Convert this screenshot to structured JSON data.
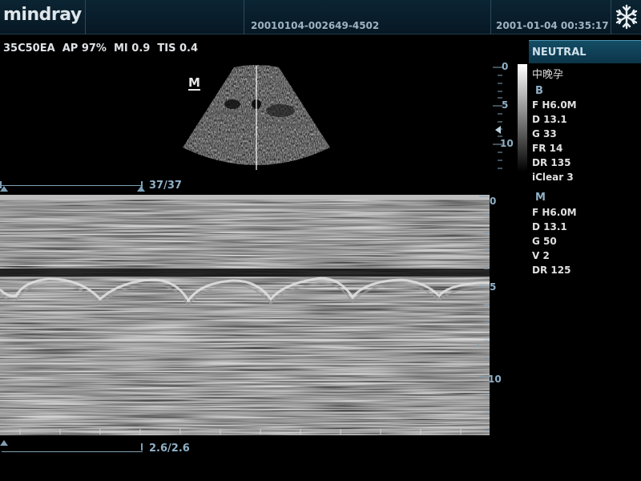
{
  "topbar": {
    "logo": "mindray",
    "patient_id": "20010104-002649-4502",
    "datetime": "2001-01-04 00:35:17",
    "freeze_icon": "snowflake-icon"
  },
  "imaging_params": "35C50EA  AP 97%  MI 0.9  TIS 0.4",
  "sector_label": "M",
  "right_panel": {
    "preset": "NEUTRAL",
    "exam": "中晚孕",
    "b_mode": {
      "title": "B",
      "params": [
        "F H6.0M",
        "D 13.1",
        "G 33",
        "FR 14",
        "DR 135",
        "iClear 3"
      ]
    },
    "m_mode": {
      "title": "M",
      "params": [
        "F H6.0M",
        "D 13.1",
        "G 50",
        "V 2",
        "DR 125"
      ]
    }
  },
  "top_scale": {
    "ticks": [
      "0",
      "5",
      "10"
    ]
  },
  "mmode_scale": {
    "ticks": [
      "0",
      "5",
      "10"
    ]
  },
  "sliders": {
    "frame": "37/37",
    "speed": "2.6/2.6"
  },
  "colors": {
    "accent": "#8fb0c6",
    "panel_tab": "#134d66",
    "topbar": "#0b2433"
  }
}
